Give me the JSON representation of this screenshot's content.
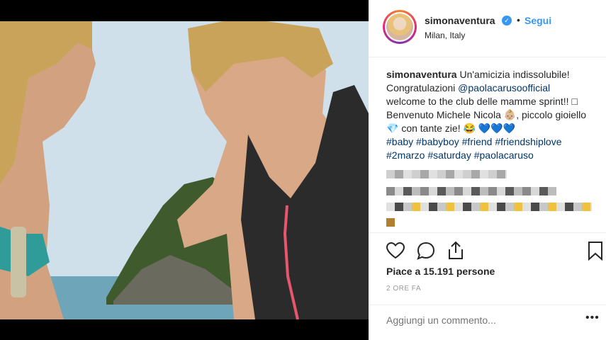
{
  "post": {
    "username": "simonaventura",
    "follow_label": "Segui",
    "separator": "•",
    "location": "Milan, Italy",
    "caption_user": "simonaventura",
    "caption_lines": [
      "Un'amicizia indissolubile!",
      "Congratulazioni ",
      "welcome to the club delle mamme sprint!! □",
      "Benvenuto Michele Nicola 👶🏼, piccolo gioiello",
      "💎 con tante zie! 😂 💙💙💙"
    ],
    "mention": "@paolacarusoofficial",
    "hashtags_line1": "#baby #babyboy #friend #friendshiplove",
    "hashtags_line2": "#2marzo #saturday #paolacaruso",
    "likes": "Piace a 15.191 persone",
    "time": "2 ORE FA",
    "comment_placeholder": "Aggiungi un commento...",
    "more_icon": "more-options-icon"
  },
  "colors": {
    "link": "#3897f0",
    "mention": "#003569",
    "text": "#262626",
    "muted": "#999999"
  }
}
